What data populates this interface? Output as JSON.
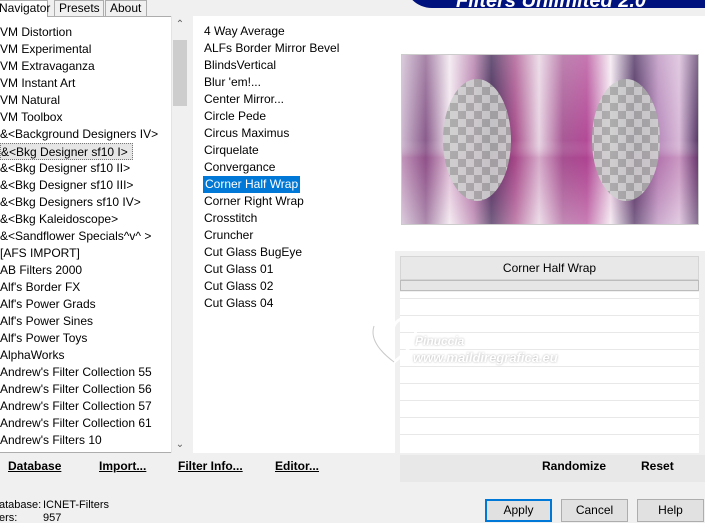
{
  "tabs": [
    {
      "label": "Navigator",
      "active": true
    },
    {
      "label": "Presets",
      "active": false
    },
    {
      "label": "About",
      "active": false
    }
  ],
  "banner": {
    "text": "Filters Unlimited 2.0"
  },
  "categories": [
    "VM Distortion",
    "VM Experimental",
    "VM Extravaganza",
    "VM Instant Art",
    "VM Natural",
    "VM Toolbox",
    "&<Background Designers IV>",
    "&<Bkg Designer sf10 I>",
    "&<Bkg Designer sf10 II>",
    "&<Bkg Designer sf10 III>",
    "&<Bkg Designers sf10 IV>",
    "&<Bkg Kaleidoscope>",
    "&<Sandflower Specials^v^ >",
    "[AFS IMPORT]",
    "AB Filters 2000",
    "Alf's Border FX",
    "Alf's Power Grads",
    "Alf's Power Sines",
    "Alf's Power Toys",
    "AlphaWorks",
    "Andrew's Filter Collection 55",
    "Andrew's Filter Collection 56",
    "Andrew's Filter Collection 57",
    "Andrew's Filter Collection 61",
    "Andrew's Filters 10"
  ],
  "selected_category": "&<Bkg Designer sf10 I>",
  "filters": [
    "4 Way Average",
    "ALFs Border Mirror Bevel",
    "BlindsVertical",
    "Blur 'em!...",
    "Center Mirror...",
    "Circle Pede",
    "Circus Maximus",
    "Cirquelate",
    "Convergance",
    "Corner Half Wrap",
    "Corner Right Wrap",
    "Crosstitch",
    "Cruncher",
    "Cut Glass  BugEye",
    "Cut Glass 01",
    "Cut Glass 02",
    "Cut Glass 04"
  ],
  "selected_filter": "Corner Half Wrap",
  "preview": {
    "filter_name": "Corner Half Wrap"
  },
  "watermark": {
    "line1": "Pinuccia",
    "line2": "www.maildiregrafica.eu"
  },
  "toolbar": {
    "database": "Database",
    "import": "Import...",
    "filter_info": "Filter Info...",
    "editor": "Editor...",
    "randomize": "Randomize",
    "reset": "Reset"
  },
  "status": {
    "database_label": "atabase:",
    "database_value": "ICNET-Filters",
    "filters_label": "ers:",
    "filters_value": "957"
  },
  "buttons": {
    "apply": "Apply",
    "cancel": "Cancel",
    "help": "Help"
  },
  "colors": {
    "accent": "#0078d7",
    "banner": "#00127d"
  }
}
